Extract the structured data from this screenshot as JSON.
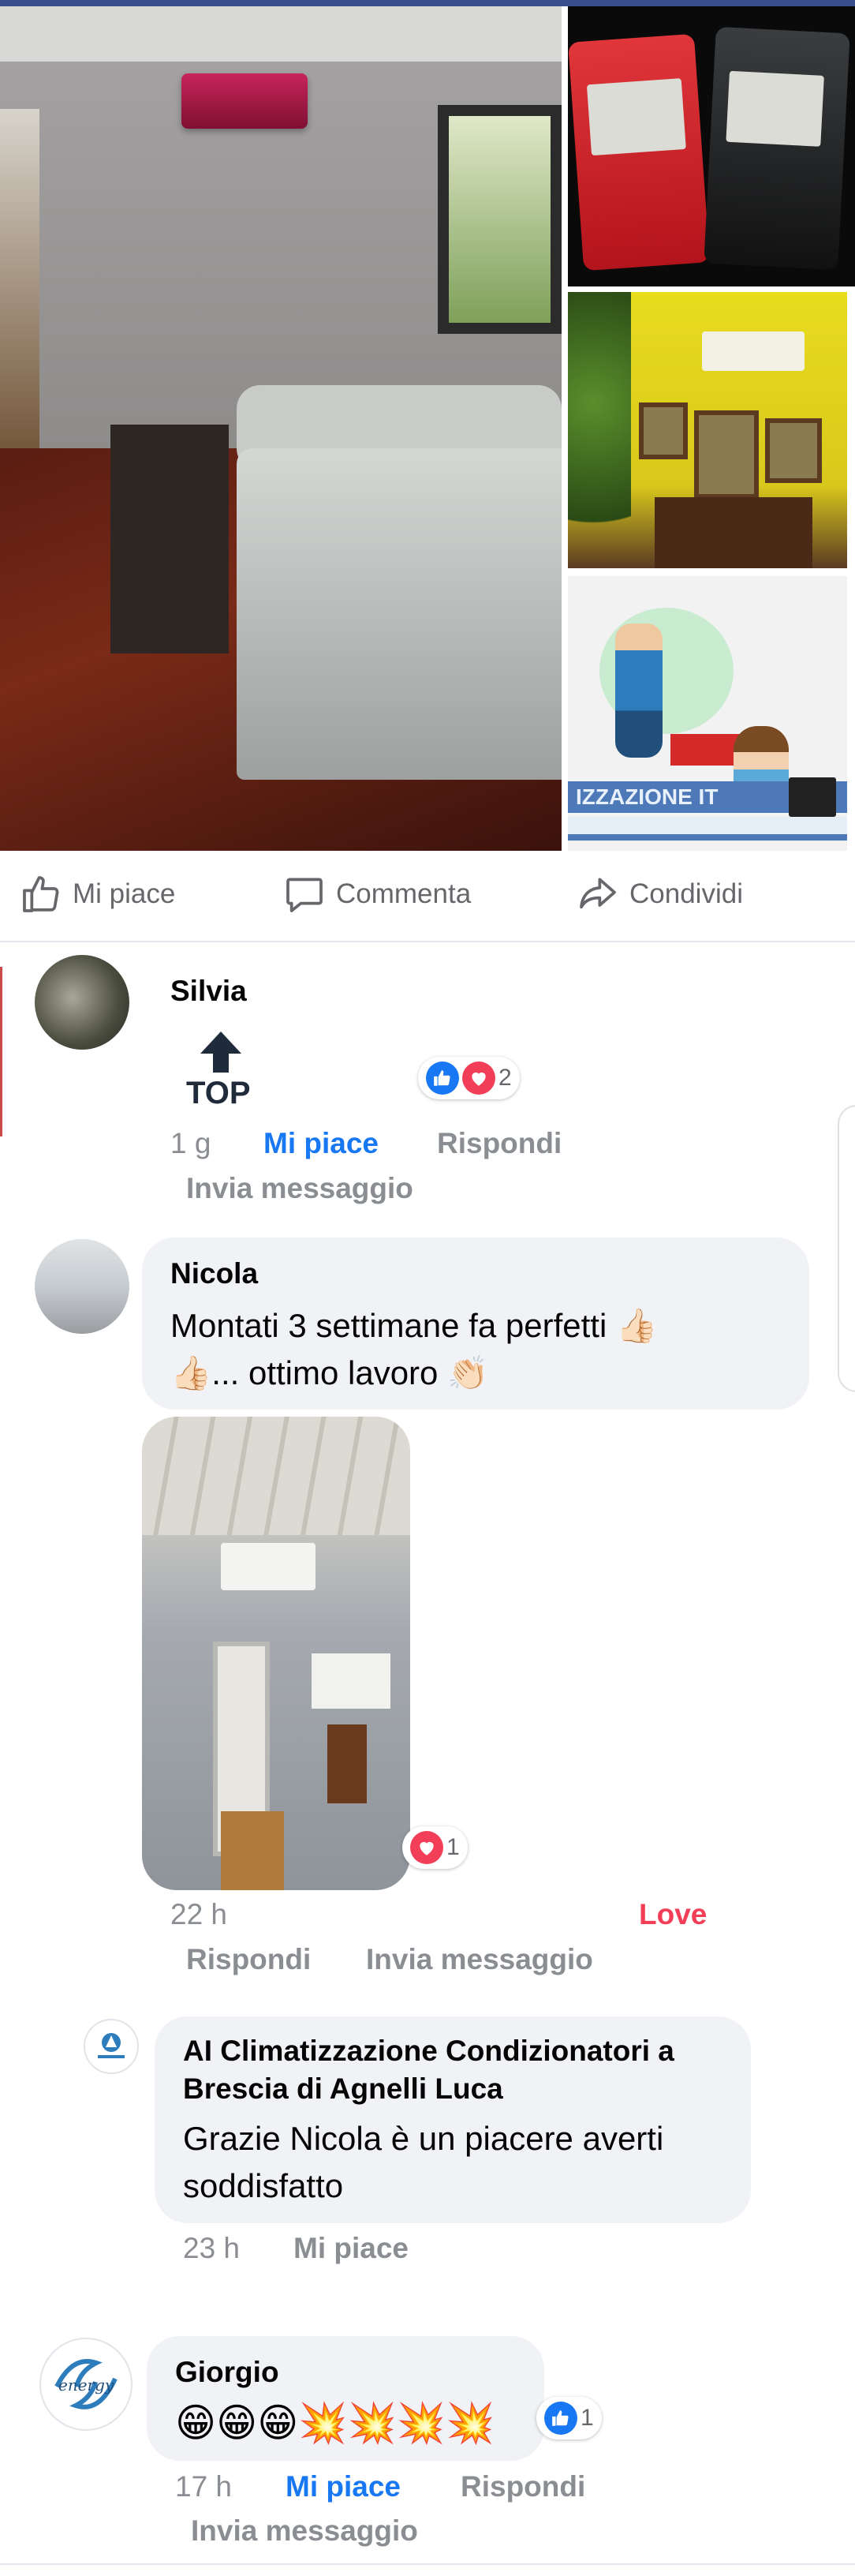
{
  "actions": {
    "like_label": "Mi piace",
    "comment_label": "Commenta",
    "share_label": "Condividi"
  },
  "photos": {
    "cartoon_banner": "IZZAZIONE IT"
  },
  "comments": [
    {
      "author": "Silvia",
      "sticker": "TOP",
      "reactions": {
        "count": "2",
        "types": [
          "like",
          "love"
        ]
      },
      "time": "1 g",
      "like": "Mi piace",
      "reply": "Rispondi",
      "message": "Invia messaggio"
    },
    {
      "author": "Nicola",
      "text_line1": "Montati 3 settimane fa perfetti 👍🏻",
      "text_line2": "👍🏻... ottimo lavoro 👏🏻",
      "image_reaction": {
        "count": "1",
        "type": "love"
      },
      "time": "22 h",
      "my_reaction": "Love",
      "reply": "Rispondi",
      "message": "Invia messaggio"
    },
    {
      "author_line1": "AI Climatizzazione Condizionatori a",
      "author_line2": "Brescia di Agnelli Luca",
      "text_line1": "Grazie Nicola è un piacere averti",
      "text_line2": "soddisfatto",
      "time": "23 h",
      "like": "Mi piace"
    },
    {
      "author": "Giorgio",
      "avatar_text": "energy",
      "text": "😁😁😁💥💥💥💥",
      "reactions": {
        "count": "1",
        "type": "like"
      },
      "time": "17 h",
      "like": "Mi piace",
      "reply": "Rispondi",
      "message": "Invia messaggio"
    }
  ],
  "colors": {
    "facebook_blue": "#1877f2",
    "love_red": "#f33e58",
    "meta_gray": "#8a8d91",
    "bubble_gray": "#f0f2f5"
  }
}
